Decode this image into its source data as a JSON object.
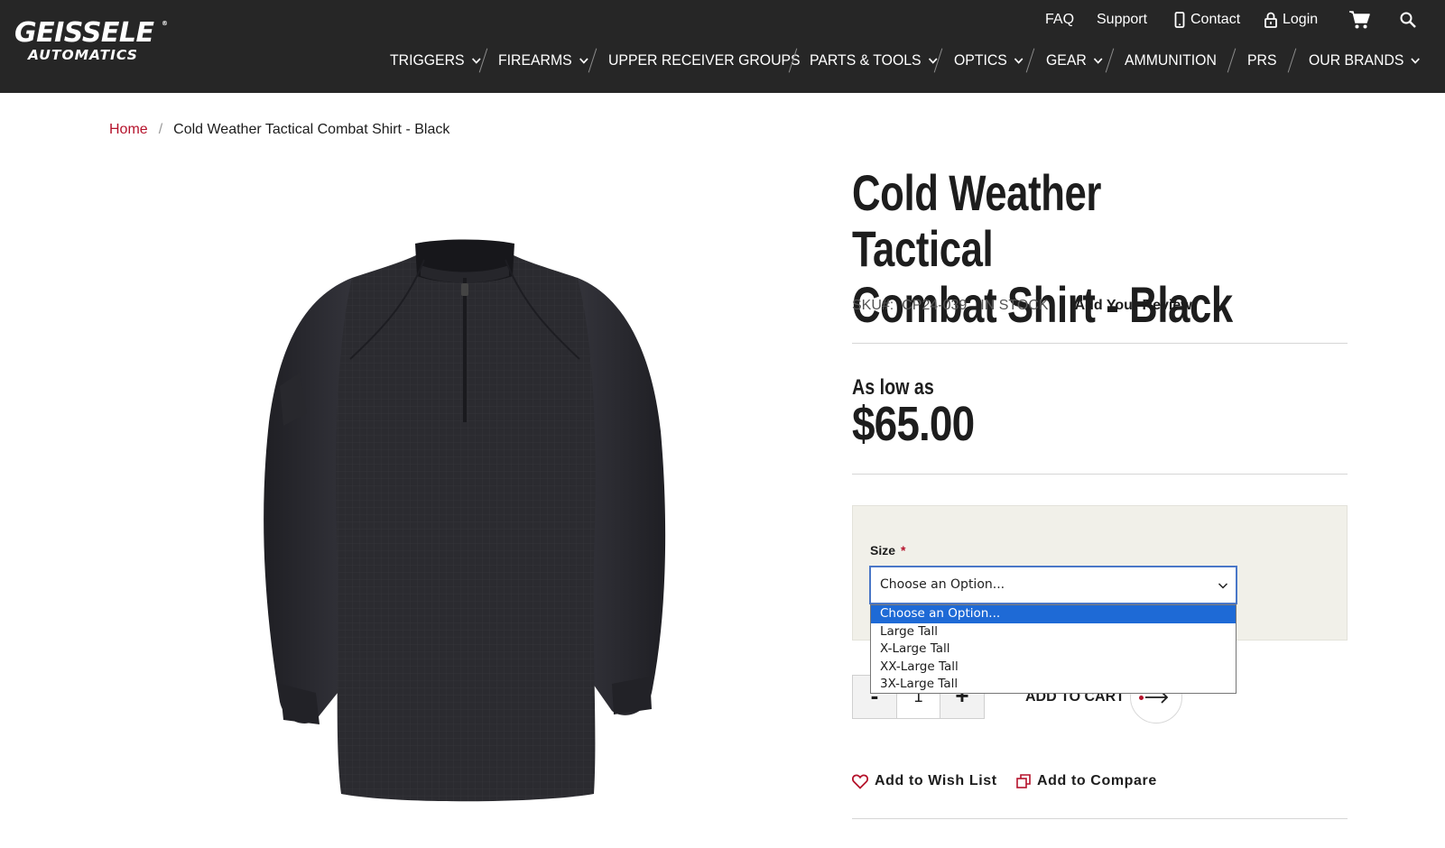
{
  "brand": {
    "line1": "GEISSELE",
    "line2": "AUTOMATICS",
    "registered": "®"
  },
  "utility_nav": {
    "faq": "FAQ",
    "support": "Support",
    "contact": "Contact",
    "login": "Login"
  },
  "main_nav": [
    {
      "label": "TRIGGERS"
    },
    {
      "label": "FIREARMS"
    },
    {
      "label": "UPPER RECEIVER GROUPS"
    },
    {
      "label": "PARTS & TOOLS"
    },
    {
      "label": "OPTICS"
    },
    {
      "label": "GEAR"
    },
    {
      "label": "AMMUNITION"
    },
    {
      "label": "PRS"
    },
    {
      "label": "OUR BRANDS"
    }
  ],
  "breadcrumb": {
    "home": "Home",
    "separator": "/",
    "current": "Cold Weather Tactical Combat Shirt - Black"
  },
  "product": {
    "title_line1": "Cold Weather Tactical",
    "title_line2": "Combat Shirt - Black",
    "sku_label": "SKU#:",
    "sku": "CP24-039",
    "stock": "In stock",
    "review_link": "Add Your Review",
    "price_prefix": "As low as",
    "price": "$65.00"
  },
  "options": {
    "size_label": "Size",
    "required_mark": "*",
    "selected": "Choose an Option...",
    "items": [
      "Choose an Option...",
      "Large Tall",
      "X-Large Tall",
      "XX-Large Tall",
      "3X-Large Tall"
    ]
  },
  "cart": {
    "minus": "-",
    "qty": "1",
    "plus": "+",
    "add_label": "ADD TO CART"
  },
  "actions": {
    "wishlist": "Add to Wish List",
    "compare": "Add to Compare"
  },
  "colors": {
    "header_bg": "#262626",
    "accent_red": "#b5122b",
    "select_highlight": "#1e6ad6",
    "option_box_bg": "#f1f0e9"
  }
}
